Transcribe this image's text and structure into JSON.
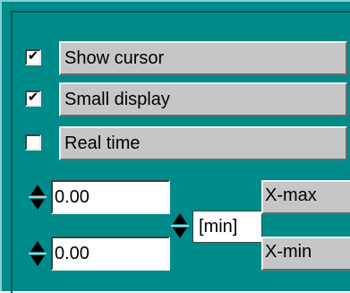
{
  "checkboxes": [
    {
      "label": "Show cursor",
      "checked": true,
      "mark": "✔"
    },
    {
      "label": "Small display",
      "checked": true,
      "mark": "✔"
    },
    {
      "label": "Real time",
      "checked": false,
      "mark": ""
    }
  ],
  "range": {
    "xmax_value": "0.00",
    "xmin_value": "0.00",
    "unit": "[min]",
    "xmax_label": "X-max",
    "xmin_label": "X-min"
  },
  "colors": {
    "panel_bg": "#008b8b",
    "label_bg": "#c6c6c6"
  }
}
